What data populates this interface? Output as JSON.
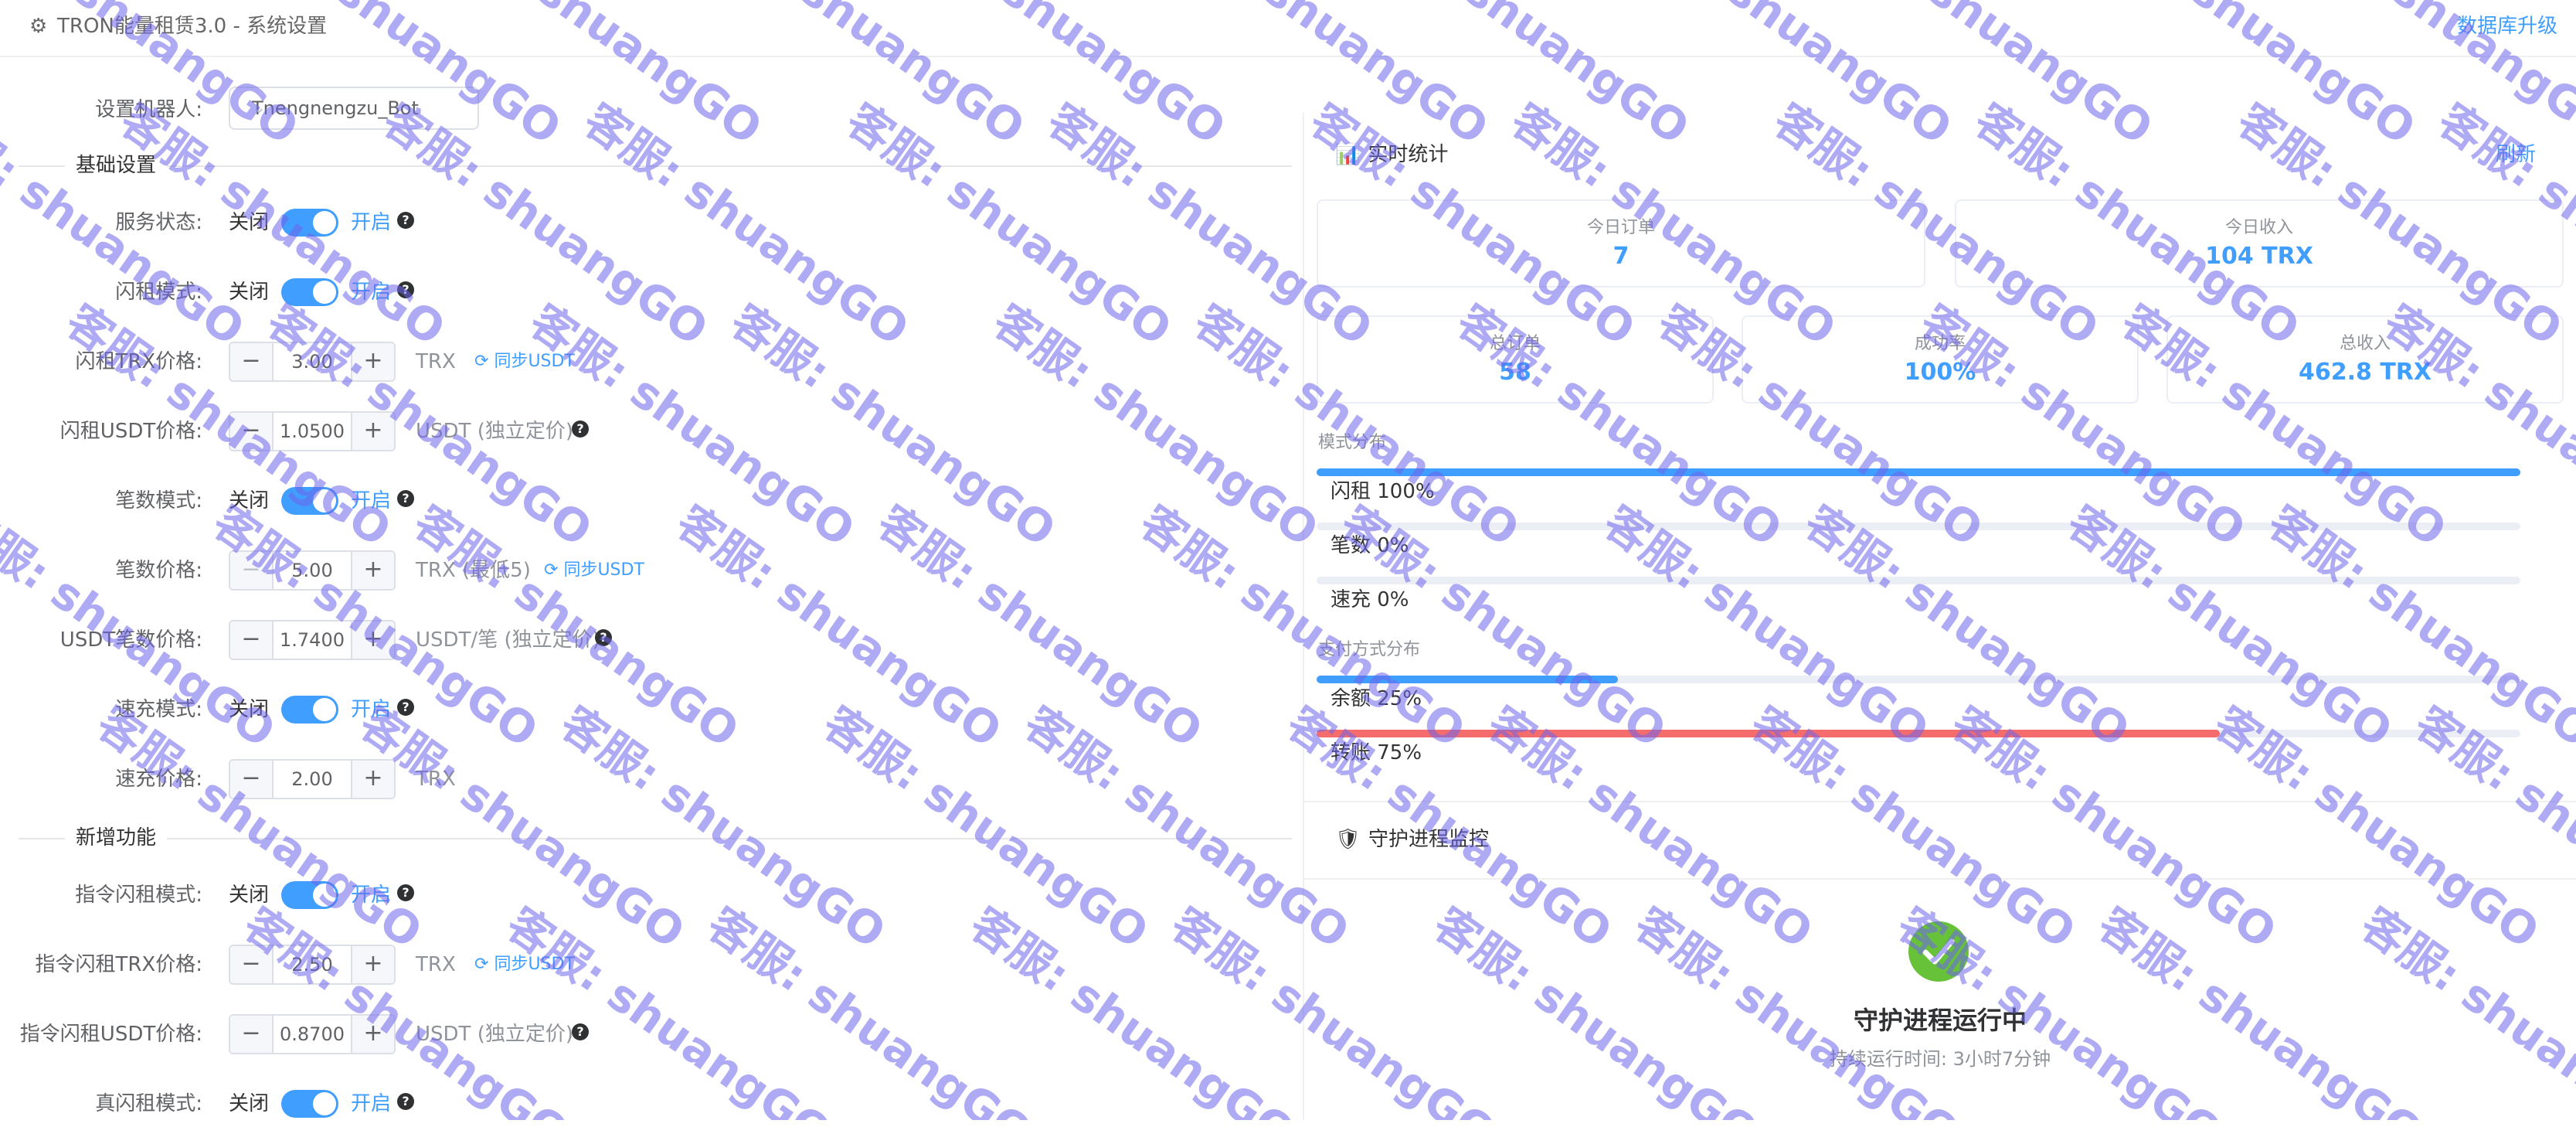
{
  "header": {
    "title": "TRON能量租赁3.0 - 系统设置",
    "db_link": "数据库升级"
  },
  "robot": {
    "label": "设置机器人:",
    "value": "Tnengnengzu_Bot"
  },
  "sections": {
    "basic": "基础设置",
    "new": "新增功能"
  },
  "switch_text": {
    "off": "关闭",
    "on": "开启"
  },
  "settings": {
    "service_status": "服务状态:",
    "flash_mode": "闪租模式:",
    "flash_trx_price": {
      "label": "闪租TRX价格:",
      "value": "3.00",
      "unit": "TRX",
      "sync": "同步USDT"
    },
    "flash_usdt_price": {
      "label": "闪租USDT价格:",
      "value": "1.0500",
      "unit": "USDT (独立定价)"
    },
    "count_mode": "笔数模式:",
    "count_price": {
      "label": "笔数价格:",
      "value": "5.00",
      "unit": "TRX (最低5)",
      "sync": "同步USDT"
    },
    "usdt_count_price": {
      "label": "USDT笔数价格:",
      "value": "1.7400",
      "unit": "USDT/笔 (独立定价)"
    },
    "quick_mode": "速充模式:",
    "quick_price": {
      "label": "速充价格:",
      "value": "2.00",
      "unit": "TRX"
    },
    "cmd_flash_mode": "指令闪租模式:",
    "cmd_flash_trx_price": {
      "label": "指令闪租TRX价格:",
      "value": "2.50",
      "unit": "TRX",
      "sync": "同步USDT"
    },
    "cmd_flash_usdt_price": {
      "label": "指令闪租USDT价格:",
      "value": "0.8700",
      "unit": "USDT (独立定价)"
    },
    "real_flash_mode": "真闪租模式:"
  },
  "stats": {
    "title": "实时统计",
    "refresh": "刷新",
    "today_orders": {
      "label": "今日订单",
      "value": "7"
    },
    "today_income": {
      "label": "今日收入",
      "value": "104 TRX"
    },
    "total_orders": {
      "label": "总订单",
      "value": "58"
    },
    "success_rate": {
      "label": "成功率",
      "value": "100%"
    },
    "total_income": {
      "label": "总收入",
      "value": "462.8 TRX"
    },
    "mode_title": "模式分布",
    "modes": [
      {
        "label": "闪租 100%",
        "pct": 100,
        "color": "#409eff"
      },
      {
        "label": "笔数 0%",
        "pct": 0,
        "color": "#409eff"
      },
      {
        "label": "速充 0%",
        "pct": 0,
        "color": "#409eff"
      }
    ],
    "pay_title": "支付方式分布",
    "pays": [
      {
        "label": "余额 25%",
        "pct": 25,
        "color": "#409eff"
      },
      {
        "label": "转账 75%",
        "pct": 75,
        "color": "#f56c6c"
      }
    ]
  },
  "guard": {
    "title": "守护进程监控",
    "status": "守护进程运行中",
    "uptime": "持续运行时间: 3小时7分钟"
  },
  "watermark": "客服: shuangGO"
}
